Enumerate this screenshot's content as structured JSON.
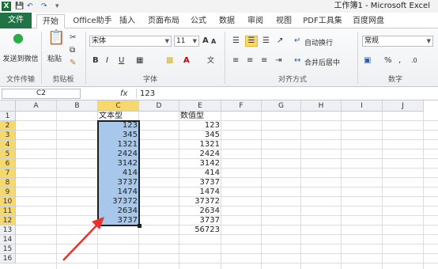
{
  "window": {
    "title": "工作簿1 - Microsoft Excel",
    "app_icon": "excel-icon",
    "quick_access": [
      "save-icon",
      "undo-icon",
      "redo-icon",
      "customize-icon"
    ]
  },
  "tabs": [
    "文件",
    "开始",
    "Office助手",
    "插入",
    "页面布局",
    "公式",
    "数据",
    "审阅",
    "视图",
    "PDF工具集",
    "百度网盘"
  ],
  "active_tab": "开始",
  "ribbon": {
    "groups": {
      "file_transfer": "文件传输",
      "clipboard": "剪贴板",
      "font": "字体",
      "alignment": "对齐方式",
      "number": "数字"
    },
    "send_to_wechat": "发送到微信",
    "paste": "粘贴",
    "font_name": "宋体",
    "font_size": "11",
    "font_buttons": [
      "B",
      "I",
      "U"
    ],
    "wrap_text": "自动换行",
    "merge_center": "合并后居中",
    "number_format": "常规",
    "number_symbols": [
      "%",
      ","
    ],
    "grow_font": "A",
    "shrink_font": "A",
    "wen": "文"
  },
  "formula_bar": {
    "name_box": "C2",
    "fx": "fx",
    "value": "123"
  },
  "columns": [
    "A",
    "B",
    "C",
    "D",
    "E",
    "F",
    "G",
    "H",
    "I",
    "J"
  ],
  "rows": [
    "1",
    "2",
    "3",
    "4",
    "5",
    "6",
    "7",
    "8",
    "9",
    "10",
    "11",
    "12",
    "13",
    "14",
    "15",
    "16"
  ],
  "sheet": {
    "c_header": "文本型",
    "e_header": "数值型",
    "c_values": [
      "123",
      "345",
      "1321",
      "2424",
      "3142",
      "414",
      "3737",
      "1474",
      "37372",
      "2634",
      "3737"
    ],
    "e_values": [
      "123",
      "345",
      "1321",
      "2424",
      "3142",
      "414",
      "3737",
      "1474",
      "37372",
      "2634",
      "3737",
      "56723"
    ]
  },
  "colors": {
    "file_tab": "#217346",
    "selection_fill": "#a7c7eb",
    "header_highlight": "#f7d96b",
    "annotation_arrow": "#e8322b"
  },
  "annotation": "red-arrow"
}
